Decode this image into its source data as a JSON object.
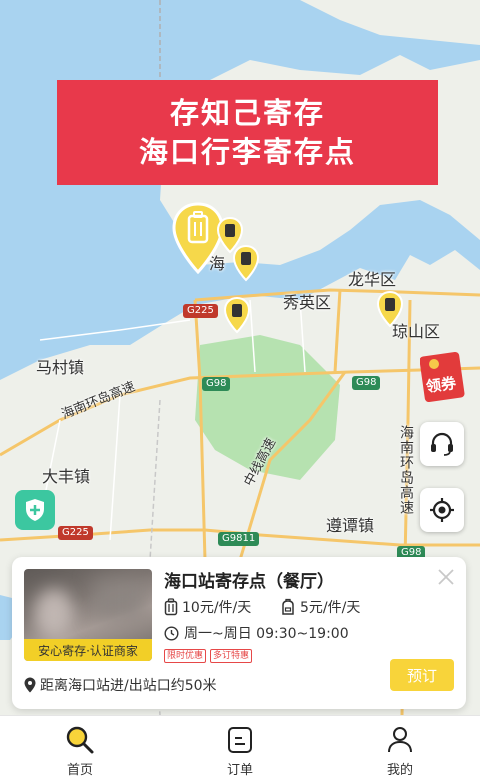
{
  "banner": {
    "line1": "存知己寄存",
    "line2": "海口行李寄存点"
  },
  "map_labels": {
    "haikou": "海",
    "longhua": "龙华区",
    "xiuying": "秀英区",
    "qiongshan": "琼山区",
    "macun": "马村镇",
    "dafeng": "大丰镇",
    "zuntan": "遵谭镇",
    "ring_expressway_w": "海南环岛高速",
    "ring_expressway_e": "海南环岛高速",
    "zhongxian": "中线高速",
    "road_g225_a": "G225",
    "road_g225_b": "G225",
    "road_g98_a": "G98",
    "road_g98_b": "G98",
    "road_g9811": "G9811",
    "road_g98_c": "G98"
  },
  "coupon_label": "领券",
  "store": {
    "name": "海口站寄存点（餐厅）",
    "badge": "安心寄存·认证商家",
    "price_large": "10元/件/天",
    "price_small": "5元/件/天",
    "hours": "周一~周日 09:30~19:00",
    "tags": [
      "限时优惠",
      "多订特惠"
    ],
    "distance": "距离海口站进/出站口约50米",
    "book_label": "预订"
  },
  "tabs": [
    {
      "label": "首页",
      "icon": "search-icon",
      "active": true
    },
    {
      "label": "订单",
      "icon": "order-icon",
      "active": false
    },
    {
      "label": "我的",
      "icon": "user-icon",
      "active": false
    }
  ],
  "colors": {
    "accent": "#f8d43a",
    "banner": "#e8394b",
    "sea": "#a9d3f0",
    "land": "#eef0ea",
    "park": "#b6e2b0"
  }
}
